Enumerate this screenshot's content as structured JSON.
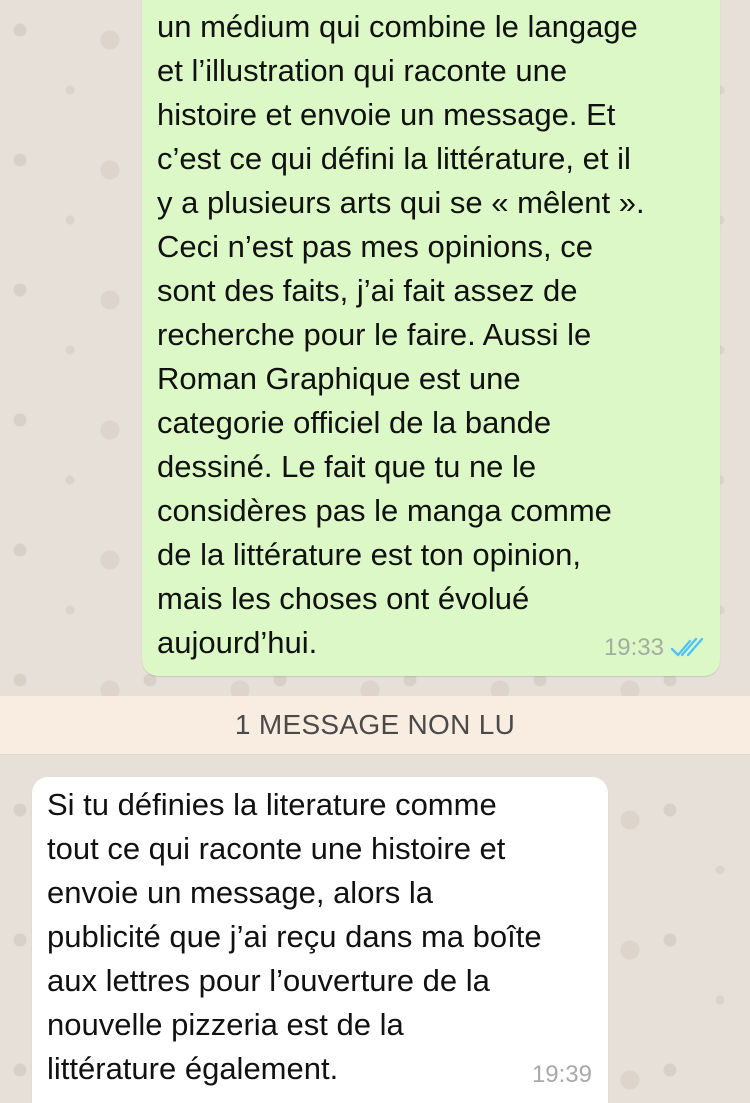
{
  "messages": {
    "outgoing": {
      "text": "un médium qui combine le langage\net l’illustration qui raconte une\nhistoire et envoie un message. Et\nc’est ce qui défini la littérature, et il\ny a plusieurs arts qui se « mêlent ».\nCeci n’est pas mes opinions, ce\nsont des faits, j’ai fait assez de\nrecherche pour le faire. Aussi le\nRoman Graphique est une\ncategorie officiel de la bande\ndessiné. Le fait que tu ne le\nconsidères pas le manga comme\nde la littérature est ton opinion,\nmais les choses ont évolué\naujourd’hui.",
      "time": "19:33",
      "status_icon": "double-check-read-icon",
      "status_color": "#4fc3f7",
      "bubble_color": "#dcf8c6"
    },
    "unread_banner": "1 MESSAGE NON LU",
    "incoming": {
      "text": "Si tu définies la literature comme\ntout ce qui raconte une histoire et\nenvoie un message, alors la\npublicité que j’ai reçu dans ma boîte\naux lettres pour l’ouverture de la\nnouvelle pizzeria est de la\nlittérature également.",
      "time": "19:39",
      "bubble_color": "#ffffff"
    }
  },
  "colors": {
    "wallpaper": "#e7e0d8",
    "banner": "#f9ece0"
  }
}
